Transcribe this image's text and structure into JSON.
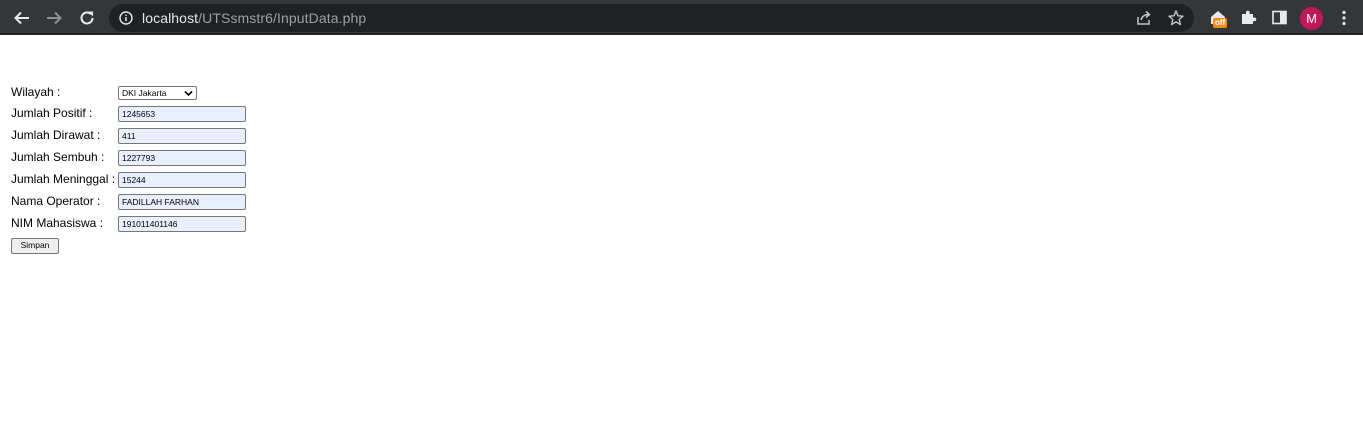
{
  "browser": {
    "url_host": "localhost",
    "url_path": "/UTSsmstr6/InputData.php",
    "extension_badge": "off",
    "profile_initial": "M",
    "icons": [
      "back-icon",
      "forward-icon",
      "reload-icon",
      "info-icon",
      "share-icon",
      "star-icon",
      "extension-house-icon",
      "puzzle-icon",
      "side-panel-icon",
      "menu-icon"
    ],
    "colors": {
      "toolbar": "#35363a",
      "omnibox": "#202124",
      "avatar": "#c2185b",
      "badge": "#f28b1e"
    }
  },
  "form": {
    "wilayah_label": "Wilayah :",
    "wilayah_value": "DKI Jakarta",
    "positif_label": "Jumlah Positif :",
    "positif_value": "1245653",
    "dirawat_label": "Jumlah Dirawat :",
    "dirawat_value": "411",
    "sembuh_label": "Jumlah Sembuh :",
    "sembuh_value": "1227793",
    "meninggal_label": "Jumlah Meninggal :",
    "meninggal_value": "15244",
    "operator_label": "Nama Operator :",
    "operator_value": "FADILLAH FARHAN",
    "nim_label": "NIM Mahasiswa :",
    "nim_value": "191011401146",
    "submit_label": "Simpan",
    "colors": {
      "autofill_bg": "#e8f0fe"
    }
  }
}
